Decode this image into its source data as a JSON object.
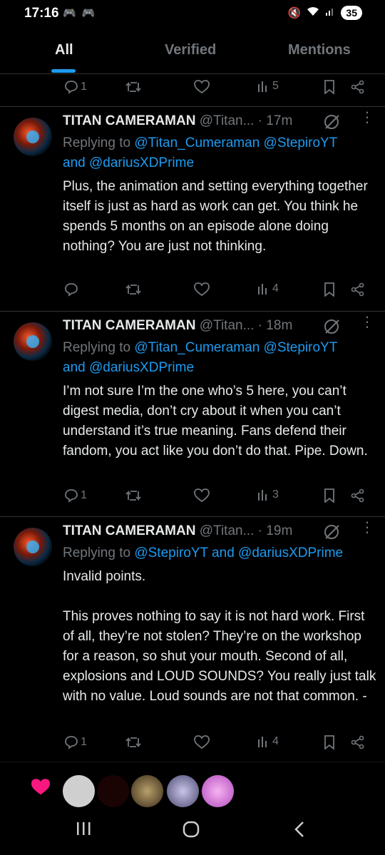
{
  "status_bar": {
    "time": "17:16",
    "app_icons": "🎮 🎮",
    "battery": "35"
  },
  "tabs": [
    {
      "label": "All"
    },
    {
      "label": "Verified"
    },
    {
      "label": "Mentions"
    }
  ],
  "top_actions": {
    "replies": "1",
    "views": "5"
  },
  "tweets": [
    {
      "name": "TITAN CAMERAMAN",
      "handle": "@Titan...",
      "time": "· 17m",
      "replying_prefix": "Replying to ",
      "replying_a": "@Titan_Cumeraman @StepiroYT",
      "replying_and": "and ",
      "replying_b": "@dariusXDPrime",
      "text": "Plus, the animation and setting everything together itself is just as hard as work can get. You think he spends 5 months on an episode alone doing nothing? You are just not thinking.",
      "replies": "",
      "views": "4"
    },
    {
      "name": "TITAN CAMERAMAN",
      "handle": "@Titan...",
      "time": "· 18m",
      "replying_prefix": "Replying to ",
      "replying_a": "@Titan_Cumeraman @StepiroYT",
      "replying_and": "and ",
      "replying_b": "@dariusXDPrime",
      "text": "I’m not sure I’m the one who’s 5 here, you can’t digest media, don’t cry about it when you can’t understand it’s true meaning. Fans defend their fandom, you act like you don’t do that. Pipe. Down.",
      "replies": "1",
      "views": "3"
    },
    {
      "name": "TITAN CAMERAMAN",
      "handle": "@Titan...",
      "time": "· 19m",
      "replying_prefix": "Replying to ",
      "replying_a": "@StepiroYT",
      "replying_and": " and ",
      "replying_b": "@dariusXDPrime",
      "text": "Invalid points.\n\nThis proves nothing to say it is not hard work. First of all, they’re not stolen? They’re on the workshop for a reason, so shut your mouth. Second of all, explosions and LOUD SOUNDS? You really just talk with no value. Loud sounds are not that common. -",
      "replies": "1",
      "views": "4"
    }
  ],
  "colors": {
    "accent": "#1d9bf0",
    "muted": "#71767b",
    "like": "#f91880"
  }
}
